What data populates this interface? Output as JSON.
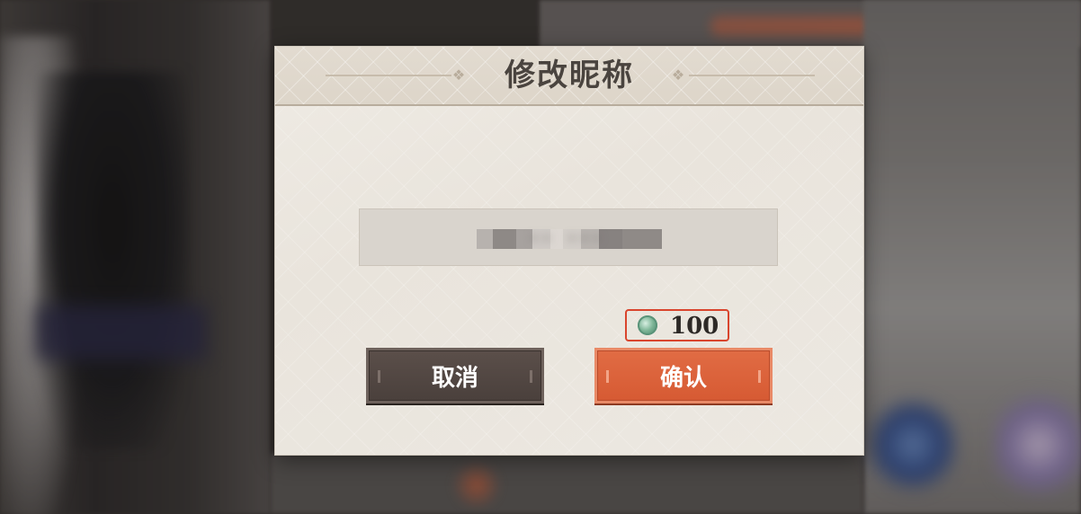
{
  "dialog": {
    "title": "修改昵称",
    "nickname_field": {
      "value": "ꞏꞏ ꞏꞏꞏ"
    },
    "cost": {
      "icon": "jade-gem-icon",
      "amount": "100"
    },
    "buttons": {
      "cancel_label": "取消",
      "confirm_label": "确认"
    }
  },
  "colors": {
    "confirm_accent": "#d65a33",
    "cancel_dark": "#4a403c",
    "highlight_border": "#d9452d"
  }
}
